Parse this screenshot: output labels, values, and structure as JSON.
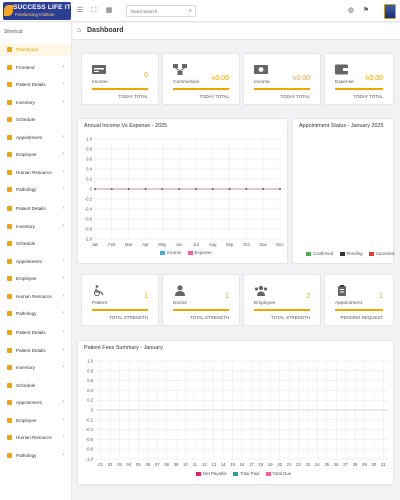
{
  "topbar": {
    "logo_title": "SUCCESS LIFE IT",
    "logo_subtitle": "Freelancing Institute",
    "search_placeholder": "Need Search"
  },
  "sidebar": {
    "shortcut_label": "Shortcut",
    "items": [
      {
        "label": "Dashboard",
        "active": true,
        "chevron": false
      },
      {
        "label": "Frontend",
        "chevron": true
      },
      {
        "label": "Patient Details",
        "chevron": true
      },
      {
        "label": "Inventory",
        "chevron": true
      },
      {
        "label": "Schedule",
        "chevron": false
      },
      {
        "label": "Appointment",
        "chevron": true
      },
      {
        "label": "Employee",
        "chevron": true
      },
      {
        "label": "Human Resource",
        "chevron": true
      },
      {
        "label": "Pathology",
        "chevron": true
      },
      {
        "label": "Patient Details",
        "chevron": true
      },
      {
        "label": "Inventory",
        "chevron": true
      },
      {
        "label": "Schedule",
        "chevron": false
      },
      {
        "label": "Appointment",
        "chevron": true
      },
      {
        "label": "Employee",
        "chevron": true
      },
      {
        "label": "Human Resource",
        "chevron": true
      },
      {
        "label": "Pathology",
        "chevron": true
      },
      {
        "label": "Patient Details",
        "chevron": true
      },
      {
        "label": "Patient Details",
        "chevron": true
      },
      {
        "label": "Inventory",
        "chevron": true
      },
      {
        "label": "Schedule",
        "chevron": false
      },
      {
        "label": "Appointment",
        "chevron": true
      },
      {
        "label": "Employee",
        "chevron": true
      },
      {
        "label": "Human Resource",
        "chevron": true
      },
      {
        "label": "Pathology",
        "chevron": true
      }
    ]
  },
  "page": {
    "title": "Dashboard"
  },
  "stats_top": [
    {
      "label": "Income",
      "value": "0",
      "sub": "TODAY TOTAL",
      "icon": "money-icon"
    },
    {
      "label": "Commission",
      "value": "৳0.00",
      "sub": "TODAY TOTAL",
      "icon": "network-icon"
    },
    {
      "label": "Income",
      "value": "৳0.00",
      "sub": "TODAY TOTAL",
      "icon": "cash-icon"
    },
    {
      "label": "Expense",
      "value": "৳0.00",
      "sub": "TODAY TOTAL",
      "icon": "wallet-icon"
    }
  ],
  "stats_bottom": [
    {
      "label": "Patient",
      "value": "1",
      "sub": "TOTAL STRENGTH",
      "icon": "wheelchair-icon"
    },
    {
      "label": "Doctor",
      "value": "1",
      "sub": "TOTAL STRENGTH",
      "icon": "doctor-icon"
    },
    {
      "label": "Employee",
      "value": "2",
      "sub": "TOTAL STRENGTH",
      "icon": "users-icon"
    },
    {
      "label": "Appointment",
      "value": "1",
      "sub": "PENDING REQUEST",
      "icon": "clipboard-icon"
    }
  ],
  "appointment_status": {
    "title": "Appointment Status - January 2025",
    "legend": [
      {
        "name": "Confirmed",
        "color": "#4caf50"
      },
      {
        "name": "Pending",
        "color": "#333333"
      },
      {
        "name": "Canceled",
        "color": "#e53935"
      }
    ]
  },
  "colors": {
    "accent": "#f0a500",
    "income": "#4fa8e0",
    "expense": "#f06292"
  },
  "chart_data": [
    {
      "type": "line",
      "title": "Annual Income Vs Expense - 2025",
      "categories": [
        "Jan",
        "Feb",
        "Mar",
        "Apr",
        "May",
        "Jun",
        "Jul",
        "Aug",
        "Sep",
        "Oct",
        "Nov",
        "Dec"
      ],
      "series": [
        {
          "name": "Income",
          "values": [
            0,
            0,
            0,
            0,
            0,
            0,
            0,
            0,
            0,
            0,
            0,
            0
          ],
          "color": "#4fa8e0"
        },
        {
          "name": "Expense",
          "values": [
            0,
            0,
            0,
            0,
            0,
            0,
            0,
            0,
            0,
            0,
            0,
            0
          ],
          "color": "#f06292"
        }
      ],
      "ylim": [
        -1.0,
        1.0
      ],
      "yticks": [
        "1.0",
        "0.8",
        "0.6",
        "0.4",
        "0.2",
        "0",
        "-0.2",
        "-0.4",
        "-0.6",
        "-0.8",
        "-1.0"
      ],
      "grid": true,
      "legend": "bottom"
    },
    {
      "type": "bar",
      "title": "Patient Fees Summary - January",
      "categories": [
        "01",
        "02",
        "03",
        "04",
        "05",
        "06",
        "07",
        "08",
        "09",
        "10",
        "11",
        "12",
        "13",
        "14",
        "15",
        "16",
        "17",
        "18",
        "19",
        "20",
        "21",
        "22",
        "23",
        "24",
        "25",
        "26",
        "27",
        "28",
        "29",
        "30",
        "31"
      ],
      "series": [
        {
          "name": "Net Payable",
          "color": "#e91e63"
        },
        {
          "name": "Total Paid",
          "color": "#26a69a"
        },
        {
          "name": "Total Due",
          "color": "#f06292"
        }
      ],
      "ylim": [
        -1.0,
        1.0
      ],
      "yticks": [
        "1.0",
        "0.8",
        "0.6",
        "0.4",
        "0.2",
        "0",
        "-0.2",
        "-0.4",
        "-0.6",
        "-0.8",
        "-1.0"
      ],
      "grid": true,
      "legend": "bottom"
    }
  ]
}
